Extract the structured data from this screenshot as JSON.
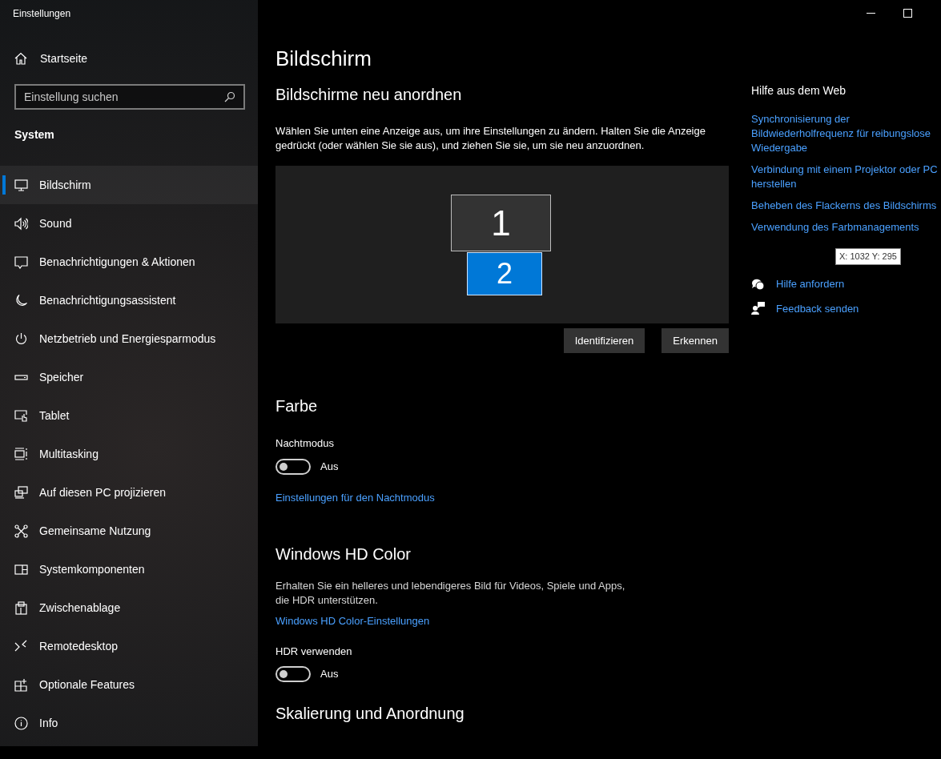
{
  "window": {
    "title": "Einstellungen"
  },
  "sidebar": {
    "home": "Startseite",
    "search": {
      "placeholder": "Einstellung suchen"
    },
    "section": "System",
    "items": [
      {
        "label": "Bildschirm",
        "selected": true
      },
      {
        "label": "Sound",
        "selected": false
      },
      {
        "label": "Benachrichtigungen & Aktionen",
        "selected": false
      },
      {
        "label": "Benachrichtigungsassistent",
        "selected": false
      },
      {
        "label": "Netzbetrieb und Energiesparmodus",
        "selected": false
      },
      {
        "label": "Speicher",
        "selected": false
      },
      {
        "label": "Tablet",
        "selected": false
      },
      {
        "label": "Multitasking",
        "selected": false
      },
      {
        "label": "Auf diesen PC projizieren",
        "selected": false
      },
      {
        "label": "Gemeinsame Nutzung",
        "selected": false
      },
      {
        "label": "Systemkomponenten",
        "selected": false
      },
      {
        "label": "Zwischenablage",
        "selected": false
      },
      {
        "label": "Remotedesktop",
        "selected": false
      },
      {
        "label": "Optionale Features",
        "selected": false
      },
      {
        "label": "Info",
        "selected": false
      }
    ]
  },
  "page": {
    "title": "Bildschirm",
    "arrange": {
      "heading": "Bildschirme neu anordnen",
      "description": "Wählen Sie unten eine Anzeige aus, um ihre Einstellungen zu ändern. Halten Sie die Anzeige gedrückt (oder wählen Sie sie aus), und ziehen Sie sie, um sie neu anzuordnen.",
      "displays": [
        {
          "label": "1",
          "selected": false
        },
        {
          "label": "2",
          "selected": true
        }
      ],
      "buttons": [
        "Identifizieren",
        "Erkennen"
      ]
    },
    "color": {
      "heading": "Farbe",
      "toggle": {
        "label": "Nachtmodus",
        "on": false,
        "state_text": "Aus"
      },
      "link": "Einstellungen für den Nachtmodus"
    },
    "hdr": {
      "heading": "Windows HD Color",
      "description": "Erhalten Sie ein helleres und lebendigeres Bild für Videos, Spiele und Apps, die HDR unterstützen.",
      "link": "Windows HD Color-Einstellungen",
      "toggle": {
        "label": "HDR verwenden",
        "on": false,
        "state_text": "Aus"
      }
    },
    "scaling": {
      "heading": "Skalierung und Anordnung"
    }
  },
  "help": {
    "heading": "Hilfe aus dem Web",
    "links": [
      "Synchronisierung der Bildwiederholfrequenz für reibungslose Wiedergabe",
      "Verbindung mit einem Projektor oder PC herstellen",
      "Beheben des Flackerns des Bildschirms",
      "Verwendung des Farbmanagements"
    ],
    "actions": [
      "Hilfe anfordern",
      "Feedback senden"
    ]
  },
  "tooltip": "X: 1032 Y: 295"
}
